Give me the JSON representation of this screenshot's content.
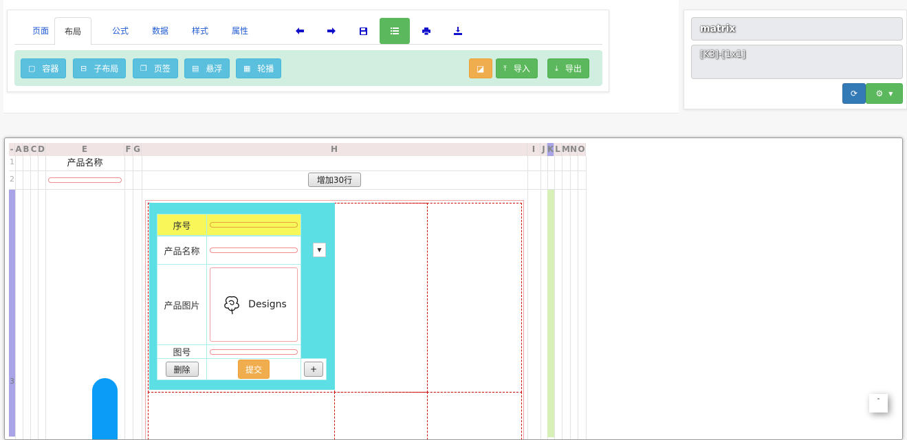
{
  "tabs": [
    {
      "label": "页面"
    },
    {
      "label": "布局"
    },
    {
      "label": "公式"
    },
    {
      "label": "数据"
    },
    {
      "label": "样式"
    },
    {
      "label": "属性"
    }
  ],
  "tool_icons": [
    "arrow-left-icon",
    "arrow-right-icon",
    "save-icon",
    "list-icon",
    "print-icon",
    "download-icon"
  ],
  "action_buttons": {
    "container": "容器",
    "sublayout": "子布局",
    "tabpage": "页签",
    "floating": "悬浮",
    "carousel": "轮播",
    "import": "导入",
    "export": "导出"
  },
  "side": {
    "matrix": "matrix",
    "cell_ref": "[K3]-[1x1]"
  },
  "sheet": {
    "columns": [
      "-",
      "A",
      "B",
      "C",
      "D",
      "E",
      "F",
      "G",
      "H",
      "I",
      "J",
      "K",
      "L",
      "M",
      "N",
      "O"
    ],
    "rows": [
      "1",
      "2",
      "3"
    ],
    "product_name_header": "产品名称",
    "add_rows_button": "增加30行"
  },
  "form": {
    "serial_label": "序号",
    "product_name_label": "产品名称",
    "product_image_label": "产品图片",
    "image_text": "Designs",
    "drawing_no_label": "图号",
    "delete_button": "删除",
    "submit_button": "提交",
    "add_button": "+"
  },
  "float_button": "-",
  "colors": {
    "accent_blue": "#337ab7",
    "success": "#5cb85c",
    "info": "#5bc0de",
    "warning": "#f0ad4e",
    "cyan": "#5cdfe4",
    "highlight": "#f7f75a"
  }
}
